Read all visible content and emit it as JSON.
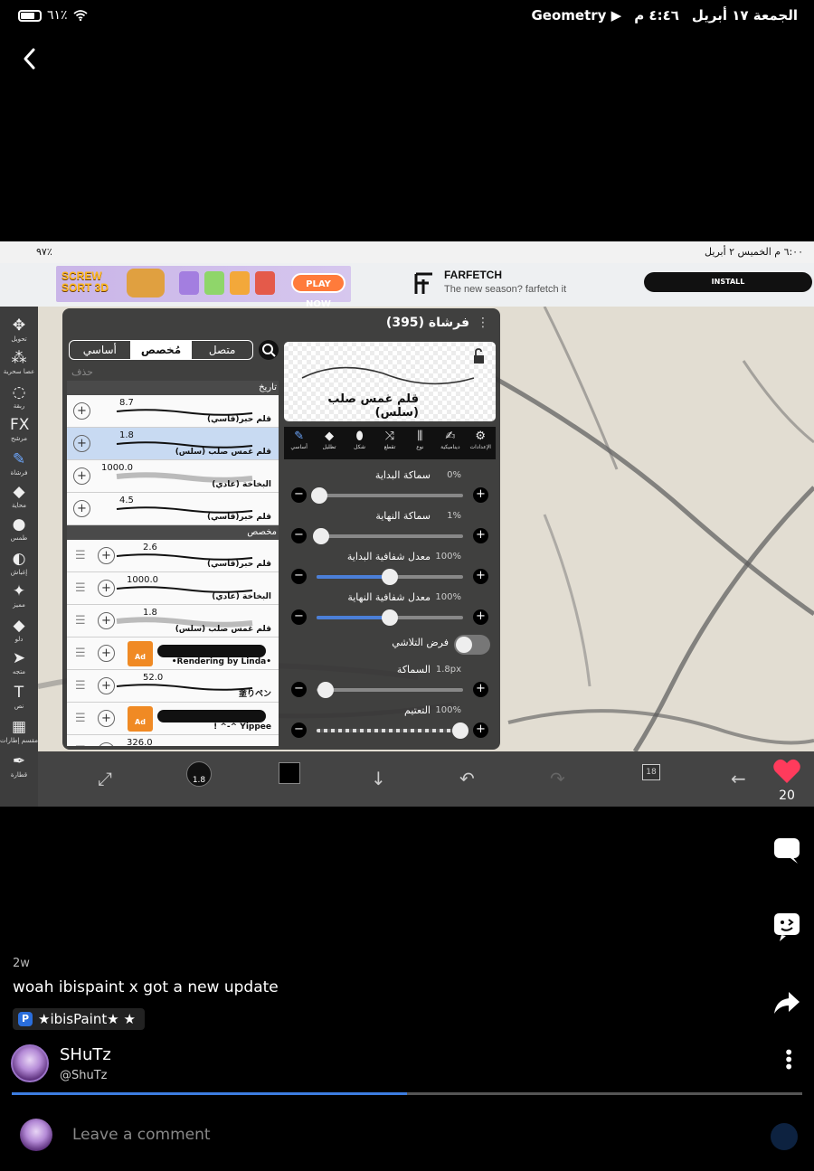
{
  "outer_status": {
    "battery": "٦١٪",
    "date": "الجمعة ١٧ أبريل",
    "time": "٤:٤٦ م",
    "app": "Geometry"
  },
  "inner_status": {
    "left": "٩٧٪",
    "right": "٦:٠٠ م  الخميس ٢ أبريل"
  },
  "ads": {
    "game_title": "SCREW SORT 3D",
    "play_now": "PLAY NOW",
    "brand": "FARFETCH",
    "tagline": "The new season? farfetch it",
    "install": "INSTALL"
  },
  "toolbar": [
    {
      "icon": "move-icon",
      "glyph": "✥",
      "label": "تحويل"
    },
    {
      "icon": "magic-wand-icon",
      "glyph": "⁂",
      "label": "عصا سحرية"
    },
    {
      "icon": "lasso-icon",
      "glyph": "◌",
      "label": "ربقة"
    },
    {
      "icon": "filter-icon",
      "glyph": "FX",
      "label": "مرشح"
    },
    {
      "icon": "brush-icon",
      "glyph": "✎",
      "label": "فرشاة"
    },
    {
      "icon": "eraser-icon",
      "glyph": "◆",
      "label": "محاية"
    },
    {
      "icon": "smudge-icon",
      "glyph": "●",
      "label": "طمس"
    },
    {
      "icon": "blur-icon",
      "glyph": "◐",
      "label": "إغباش"
    },
    {
      "icon": "special-icon",
      "glyph": "✦",
      "label": "مميز"
    },
    {
      "icon": "fill-icon",
      "glyph": "◆",
      "label": "دلو"
    },
    {
      "icon": "select-icon",
      "glyph": "➤",
      "label": "متجه"
    },
    {
      "icon": "text-icon",
      "glyph": "T",
      "label": "نص"
    },
    {
      "icon": "frame-icon",
      "glyph": "▦",
      "label": "مقسم إطارات"
    },
    {
      "icon": "dropper-icon",
      "glyph": "✒",
      "label": "قطارة"
    }
  ],
  "panel": {
    "title": "فرشاة (395)",
    "segments": [
      "أساسي",
      "مُخصص",
      "متصل"
    ],
    "selected_segment": "مُخصص",
    "delete_label": "حذف",
    "history_header": "تاريخ",
    "custom_header": "مخصص",
    "history": [
      {
        "size": "8.7",
        "name": "قلم حبر(قاسي)"
      },
      {
        "size": "1.8",
        "name": "قلم غمس صلب (سلس)"
      },
      {
        "size": "1000.0",
        "name": "البخاخة (عادي)"
      },
      {
        "size": "4.5",
        "name": "قلم حبر(قاسي)"
      }
    ],
    "custom": [
      {
        "size": "2.6",
        "name": "قلم حبر(قاسي)",
        "locked": false
      },
      {
        "size": "1000.0",
        "name": "البخاخة (عادي)",
        "locked": false
      },
      {
        "size": "1.8",
        "name": "قلم غمس صلب (سلس)",
        "locked": false
      },
      {
        "size": "",
        "name": "•Rendering by Linda•",
        "locked": true
      },
      {
        "size": "52.0",
        "name": "塗りペン",
        "locked": false
      },
      {
        "size": "",
        "name": "Yippee ^-^ !",
        "locked": true
      },
      {
        "size": "326.0",
        "name": "",
        "locked": false
      }
    ],
    "ad_badge": "Ad",
    "preview_name": "قلم غمس صلب (سلس)",
    "tabs": [
      {
        "icon": "brush-tab-icon",
        "glyph": "✎",
        "label": "أساسي"
      },
      {
        "icon": "shading-tab-icon",
        "glyph": "◆",
        "label": "تظليل"
      },
      {
        "icon": "shape-tab-icon",
        "glyph": "⬮",
        "label": "شكل"
      },
      {
        "icon": "cut-tab-icon",
        "glyph": "⤨",
        "label": "تقطع"
      },
      {
        "icon": "type-tab-icon",
        "glyph": "⫼",
        "label": "نوع"
      },
      {
        "icon": "dynamics-tab-icon",
        "glyph": "✍",
        "label": "ديناميكية"
      },
      {
        "icon": "settings-tab-icon",
        "glyph": "⚙",
        "label": "الإعدادات"
      }
    ],
    "props": [
      {
        "label": "سماكة البداية",
        "value": "0%",
        "level": 0.02,
        "filled": false
      },
      {
        "label": "سماكة النهاية",
        "value": "1%",
        "level": 0.03,
        "filled": false
      },
      {
        "label": "معدل شفافية البداية",
        "value": "100%",
        "level": 0.5,
        "filled": true
      },
      {
        "label": "معدل شفافية النهاية",
        "value": "100%",
        "level": 0.5,
        "filled": true
      }
    ],
    "fade_label": "فرض التلاشي",
    "thickness": {
      "label": "السماكة",
      "value": "1.8px",
      "level": 0.06
    },
    "opacity": {
      "label": "التعتيم",
      "value": "100%",
      "level": 0.98
    }
  },
  "bottom_bar": {
    "brush_size": "1.8",
    "layers_count": "18"
  },
  "side": {
    "likes": "20"
  },
  "post": {
    "age": "2w",
    "caption": "woah ibispaint x got a new update",
    "tag": "★ibisPaint★ ★",
    "username": "SHuTz",
    "handle": "@ShuTz",
    "progress": 0.5,
    "comment_placeholder": "Leave a comment"
  }
}
